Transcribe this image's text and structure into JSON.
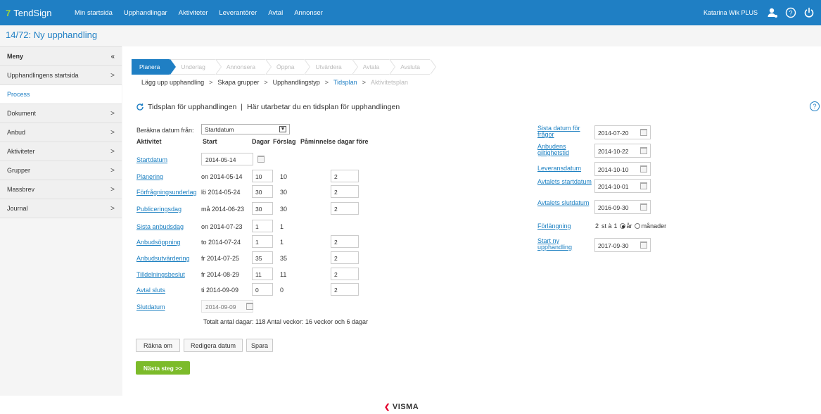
{
  "brand": {
    "name": "TendSign",
    "mark": "7"
  },
  "topnav": [
    "Min startsida",
    "Upphandlingar",
    "Aktiviteter",
    "Leverantörer",
    "Avtal",
    "Annonser"
  ],
  "user": {
    "name": "Katarina Wik PLUS"
  },
  "page": {
    "title": "14/72: Ny upphandling"
  },
  "sidebar": {
    "header": "Meny",
    "collapse": "«",
    "items": [
      {
        "label": "Upphandlingens startsida",
        "chevron": ">"
      },
      {
        "label": "Process",
        "chevron": ""
      },
      {
        "label": "Dokument",
        "chevron": ">"
      },
      {
        "label": "Anbud",
        "chevron": ">"
      },
      {
        "label": "Aktiviteter",
        "chevron": ">"
      },
      {
        "label": "Grupper",
        "chevron": ">"
      },
      {
        "label": "Massbrev",
        "chevron": ">"
      },
      {
        "label": "Journal",
        "chevron": ">"
      }
    ]
  },
  "steps": [
    "Planera",
    "Underlag",
    "Annonsera",
    "Öppna",
    "Utvärdera",
    "Avtala",
    "Avsluta"
  ],
  "crumbs": [
    "Lägg upp upphandling",
    "Skapa grupper",
    "Upphandlingstyp",
    "Tidsplan",
    "Aktivitetsplan"
  ],
  "section": {
    "title": "Tidsplan för upphandlingen",
    "sep": "|",
    "subtitle": "Här utarbetar du en tidsplan för upphandlingen"
  },
  "calc": {
    "label": "Beräkna datum från:",
    "value": "Startdatum"
  },
  "table": {
    "headers": {
      "aktivitet": "Aktivitet",
      "start": "Start",
      "dagar": "Dagar",
      "forslag": "Förslag",
      "pam": "Påminnelse dagar före"
    },
    "startdatum": {
      "label": "Startdatum",
      "value": "2014-05-14"
    },
    "rows": [
      {
        "label": "Planering",
        "start": "on 2014-05-14",
        "dagar": "10",
        "forslag": "10",
        "pam": "2"
      },
      {
        "label": "Förfrågningsunderlag",
        "start": "lö 2014-05-24",
        "dagar": "30",
        "forslag": "30",
        "pam": "2"
      },
      {
        "label": "Publiceringsdag",
        "start": "må 2014-06-23",
        "dagar": "30",
        "forslag": "30",
        "pam": "2"
      },
      {
        "label": "Sista anbudsdag",
        "start": "on 2014-07-23",
        "dagar": "1",
        "forslag": "1",
        "pam": ""
      },
      {
        "label": "Anbudsöppning",
        "start": "to 2014-07-24",
        "dagar": "1",
        "forslag": "1",
        "pam": "2"
      },
      {
        "label": "Anbudsutvärdering",
        "start": "fr 2014-07-25",
        "dagar": "35",
        "forslag": "35",
        "pam": "2"
      },
      {
        "label": "Tilldelningsbeslut",
        "start": "fr 2014-08-29",
        "dagar": "11",
        "forslag": "11",
        "pam": "2"
      },
      {
        "label": "Avtal sluts",
        "start": "ti 2014-09-09",
        "dagar": "0",
        "forslag": "0",
        "pam": "2"
      }
    ],
    "slutdatum": {
      "label": "Slutdatum",
      "value": "2014-09-09"
    },
    "total": "Totalt antal dagar: 118  Antal veckor: 16 veckor och 6 dagar"
  },
  "buttons": {
    "rakna": "Räkna om",
    "redigera": "Redigera datum",
    "spara": "Spara",
    "next": "Nästa steg >>"
  },
  "right": {
    "sista_fragor": {
      "label": "Sista datum för frågor",
      "value": "2014-07-20"
    },
    "giltighetstid": {
      "label": "Anbudens giltighetstid",
      "value": "2014-10-22"
    },
    "leveransdatum": {
      "label": "Leveransdatum",
      "value": "2014-10-10"
    },
    "avtal_start": {
      "label": "Avtalets startdatum",
      "value": "2014-10-01"
    },
    "avtal_slut": {
      "label": "Avtalets slutdatum",
      "value": "2016-09-30"
    },
    "forlangning": {
      "label": "Förlängning",
      "count": "2",
      "st": "st à",
      "len": "1",
      "opt1": "år",
      "opt2": "månader"
    },
    "start_ny": {
      "label": "Start ny upphandling",
      "value": "2017-09-30"
    }
  },
  "footer": {
    "logo": "VISMA"
  },
  "colors": {
    "primary": "#1f7fc4",
    "green": "#7cbb2a",
    "visma_red": "#e4032e"
  }
}
